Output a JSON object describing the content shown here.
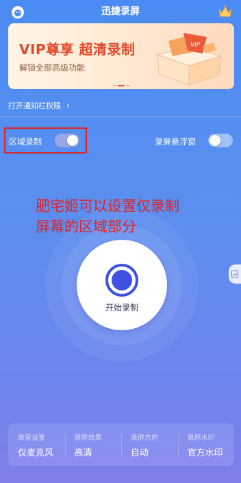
{
  "header": {
    "title": "迅捷录屏",
    "left_icon": "avatar-icon",
    "right_icon": "crown-icon"
  },
  "banner": {
    "title": "VIP尊享 超清录制",
    "subtitle": "解锁全部高级功能",
    "gift_text": "VIP"
  },
  "notice": {
    "label": "打开通知栏权限",
    "arrow": "›"
  },
  "toggles": {
    "region_label": "区域录制",
    "region_on": true,
    "float_label": "录屏悬浮窗",
    "float_on": false
  },
  "annotation": {
    "line1": "肥宅姬可以设置仅录制",
    "line2": "屏幕的区域部分"
  },
  "start": {
    "label": "开始录制"
  },
  "settings": [
    {
      "key": "录音设置",
      "value": "仅麦克风"
    },
    {
      "key": "录屏效果",
      "value": "高清"
    },
    {
      "key": "录屏方向",
      "value": "自动"
    },
    {
      "key": "录屏水印",
      "value": "官方水印"
    }
  ],
  "colors": {
    "accent": "#4a8cf3",
    "annotation": "#e52020",
    "banner_title": "#e2482b"
  }
}
